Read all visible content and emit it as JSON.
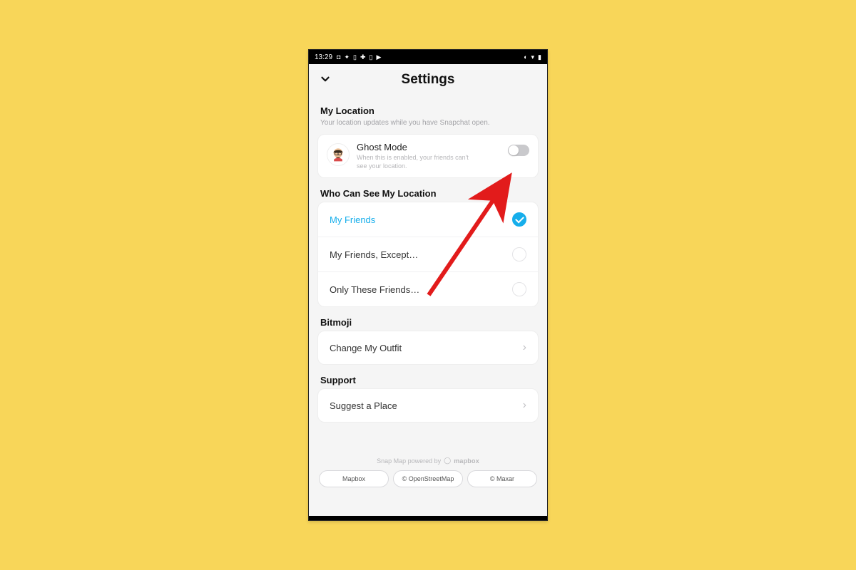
{
  "statusbar": {
    "time": "13:29"
  },
  "header": {
    "title": "Settings"
  },
  "location": {
    "title": "My Location",
    "subtitle": "Your location updates while you have Snapchat open.",
    "ghost": {
      "title": "Ghost Mode",
      "desc": "When this is enabled, your friends can't see your location.",
      "enabled": false
    }
  },
  "visibility": {
    "title": "Who Can See My Location",
    "options": [
      {
        "label": "My Friends",
        "selected": true
      },
      {
        "label": "My Friends, Except…",
        "selected": false
      },
      {
        "label": "Only These Friends…",
        "selected": false
      }
    ]
  },
  "bitmoji": {
    "title": "Bitmoji",
    "row_label": "Change My Outfit"
  },
  "support": {
    "title": "Support",
    "row_label": "Suggest a Place"
  },
  "footer": {
    "powered": "Snap Map powered by",
    "brand": "mapbox",
    "pills": [
      "Mapbox",
      "© OpenStreetMap",
      "© Maxar"
    ]
  }
}
